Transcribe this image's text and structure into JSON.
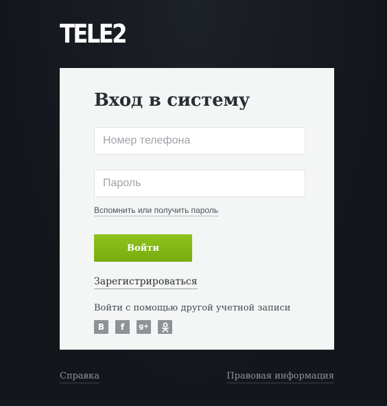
{
  "brand": {
    "logo_text": "TELE2",
    "logo_color": "#ffffff"
  },
  "login": {
    "title": "Вход в систему",
    "phone_placeholder": "Номер телефона",
    "phone_value": "",
    "password_placeholder": "Пароль",
    "password_value": "",
    "recover_link": "Вспомнить или получить пароль",
    "submit_label": "Войти",
    "register_link": "Зарегистрироваться",
    "social_caption": "Войти с помощью другой учетной записи",
    "social": [
      {
        "label": "В",
        "icon": "vk-icon"
      },
      {
        "label": "f",
        "icon": "facebook-icon"
      },
      {
        "label": "g+",
        "icon": "google-plus-icon"
      },
      {
        "label": "",
        "icon": "odnoklassniki-icon"
      }
    ]
  },
  "footer": {
    "help": "Справка",
    "legal": "Правовая информация"
  },
  "colors": {
    "background": "#13161b",
    "card": "#f4f5f5",
    "accent_green": "#83b816",
    "social_icon_bg": "#8d9296"
  }
}
